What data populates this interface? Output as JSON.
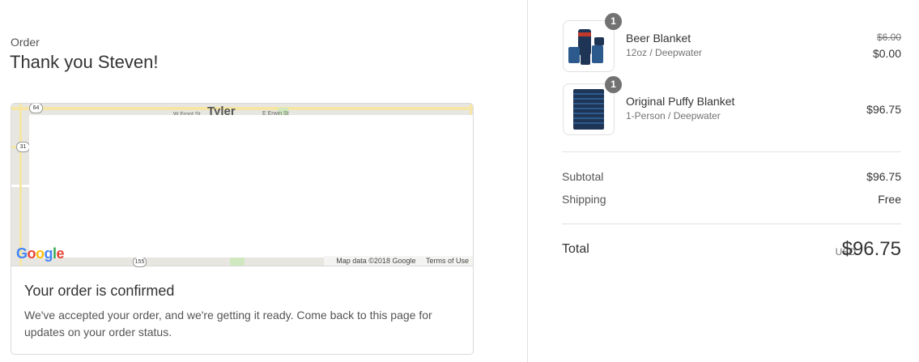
{
  "header": {
    "order_label": "Order",
    "thank_you": "Thank you Steven!"
  },
  "map": {
    "city_label": "Tyler",
    "streets": [
      "W Front St",
      "E Erwin St"
    ],
    "shields": [
      "64",
      "31",
      "155"
    ],
    "google_logo": "Google",
    "attribution": "Map data ©2018 Google",
    "terms": "Terms of Use"
  },
  "confirmation": {
    "title": "Your order is confirmed",
    "text": "We've accepted your order, and we're getting it ready. Come back to this page for updates on your order status."
  },
  "items": [
    {
      "quantity": "1",
      "name": "Beer Blanket",
      "variant": "12oz / Deepwater",
      "original_price": "$6.00",
      "price": "$0.00"
    },
    {
      "quantity": "1",
      "name": "Original Puffy Blanket",
      "variant": "1-Person / Deepwater",
      "price": "$96.75"
    }
  ],
  "summary": {
    "subtotal_label": "Subtotal",
    "subtotal_value": "$96.75",
    "shipping_label": "Shipping",
    "shipping_value": "Free",
    "total_label": "Total",
    "currency": "USD",
    "total_value": "$96.75"
  },
  "colors": {
    "accent_gray": "#727272",
    "blanket_navy": "#1f3556",
    "blanket_blue": "#2c5a8c"
  }
}
